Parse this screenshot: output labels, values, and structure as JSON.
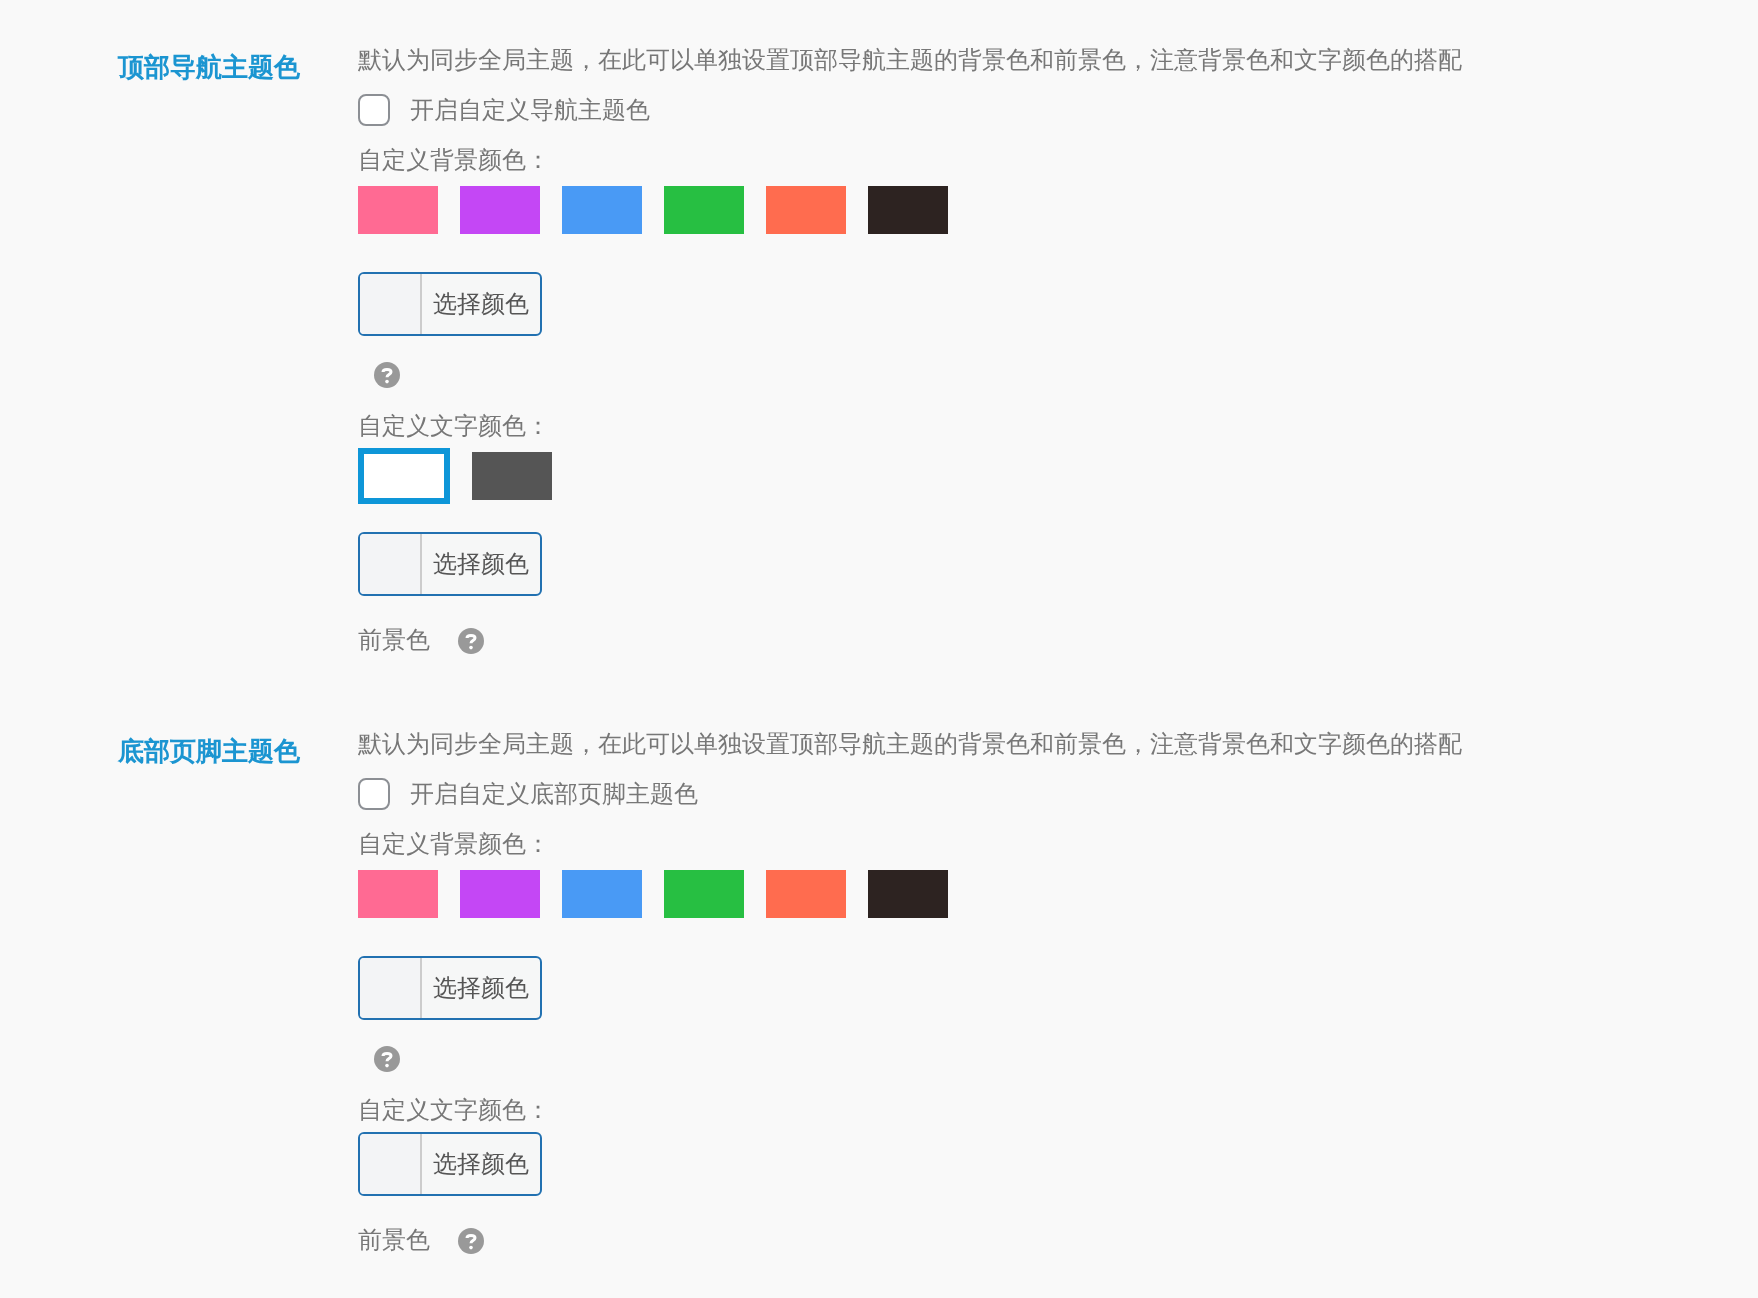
{
  "sections": [
    {
      "title": "顶部导航主题色",
      "description": "默认为同步全局主题，在此可以单独设置顶部导航主题的背景色和前景色，注意背景色和文字颜色的搭配",
      "checkbox": {
        "label": "开启自定义导航主题色",
        "checked": false
      },
      "bg_label": "自定义背景颜色：",
      "bg_swatches": [
        {
          "color": "#ff6a93",
          "selected": false
        },
        {
          "color": "#c447f5",
          "selected": false
        },
        {
          "color": "#499af5",
          "selected": false
        },
        {
          "color": "#27bf42",
          "selected": false
        },
        {
          "color": "#ff6c4f",
          "selected": false
        },
        {
          "color": "#2d2321",
          "selected": false
        }
      ],
      "bg_picker": "选择颜色",
      "text_label": "自定义文字颜色：",
      "text_swatches": [
        {
          "color": "#ffffff",
          "selected": true
        },
        {
          "color": "#555555",
          "selected": false
        }
      ],
      "text_picker": "选择颜色",
      "fg_label": "前景色"
    },
    {
      "title": "底部页脚主题色",
      "description": "默认为同步全局主题，在此可以单独设置顶部导航主题的背景色和前景色，注意背景色和文字颜色的搭配",
      "checkbox": {
        "label": "开启自定义底部页脚主题色",
        "checked": false
      },
      "bg_label": "自定义背景颜色：",
      "bg_swatches": [
        {
          "color": "#ff6a93",
          "selected": false
        },
        {
          "color": "#c447f5",
          "selected": false
        },
        {
          "color": "#499af5",
          "selected": false
        },
        {
          "color": "#27bf42",
          "selected": false
        },
        {
          "color": "#ff6c4f",
          "selected": false
        },
        {
          "color": "#2d2321",
          "selected": false
        }
      ],
      "bg_picker": "选择颜色",
      "text_label": "自定义文字颜色：",
      "text_picker": "选择颜色",
      "fg_label": "前景色"
    }
  ]
}
